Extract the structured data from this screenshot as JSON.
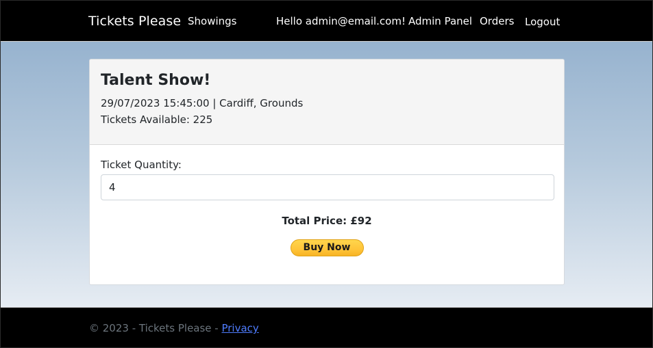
{
  "nav": {
    "brand": "Tickets Please",
    "showings": "Showings",
    "greeting": "Hello admin@email.com!",
    "admin_panel": "Admin Panel",
    "orders": "Orders",
    "logout": "Logout"
  },
  "event": {
    "title": "Talent Show!",
    "datetime_location": "29/07/2023 15:45:00 | Cardiff, Grounds",
    "tickets_available": "Tickets Available: 225"
  },
  "purchase": {
    "quantity_label": "Ticket Quantity:",
    "quantity_value": "4",
    "total_price": "Total Price: £92",
    "buy_label": "Buy Now"
  },
  "footer": {
    "copyright": "© 2023 - Tickets Please - ",
    "privacy": "Privacy"
  },
  "colors": {
    "navbar": "#000000",
    "accent_button": "#ffc439",
    "link": "#4f7dff"
  }
}
